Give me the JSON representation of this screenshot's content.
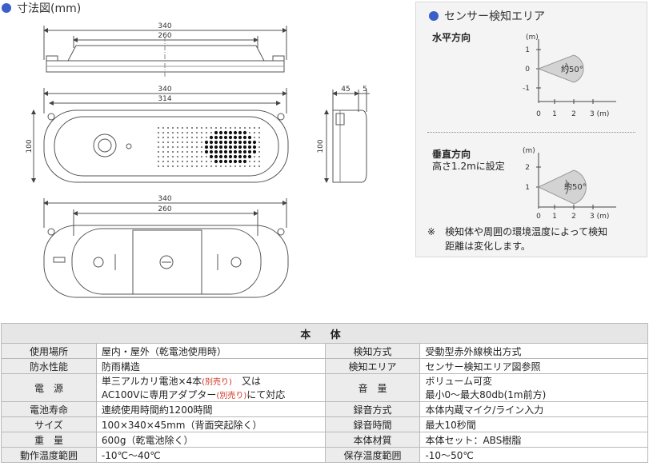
{
  "left_header": "寸法図(mm)",
  "front_view": {
    "dim_outer": "340",
    "dim_inner": "260",
    "dim_inner_b": "314",
    "height": "100"
  },
  "top_view": {
    "dim_outer": "340",
    "dim_inner": "260"
  },
  "side_view": {
    "depth": "45",
    "lip": "5",
    "height": "100"
  },
  "right_panel": {
    "header": "センサー検知エリア",
    "horizontal": {
      "label": "水平方向",
      "unit": "(m)",
      "yticks": [
        "1",
        "0",
        "-1"
      ],
      "xticks": [
        "0",
        "1",
        "2",
        "3 (m)"
      ],
      "angle": "約50°"
    },
    "vertical": {
      "label": "垂直方向",
      "sublabel": "高さ1.2mに設定",
      "unit": "(m)",
      "yticks": [
        "2",
        "1",
        "0"
      ],
      "xticks": [
        "0",
        "1",
        "2",
        "3 (m)"
      ],
      "angle": "約50°"
    },
    "note_mark": "※",
    "note_line1": "検知体や周囲の環境温度によって検知",
    "note_line2": "距離は変化します。"
  },
  "spec_table": {
    "title": "本 体",
    "rows": [
      {
        "l1": "使用場所",
        "v1": "屋内・屋外（乾電池使用時）",
        "l2": "検知方式",
        "v2": "受動型赤外線検出方式"
      },
      {
        "l1": "防水性能",
        "v1": "防雨構造",
        "l2": "検知エリア",
        "v2": "センサー検知エリア図参照"
      },
      {
        "l1": "電　源",
        "v1a": "単三アルカリ電池×4本",
        "v1a_red": "(別売り)",
        "v1a_tail": "又は",
        "v1b": "AC100Vに専用アダプター",
        "v1b_red": "(別売り)",
        "v1b_tail": "にて対応",
        "l2": "音　量",
        "v2a": "ボリューム可変",
        "v2b": "最小0〜最大80db(1m前方)"
      },
      {
        "l1": "電池寿命",
        "v1": "連続使用時間約1200時間",
        "l2": "録音方式",
        "v2": "本体内蔵マイク/ライン入力"
      },
      {
        "l1": "サイズ",
        "v1": "100×340×45mm（背面突起除く）",
        "l2": "録音時間",
        "v2": "最大10秒間"
      },
      {
        "l1": "重　量",
        "v1": "600g（乾電池除く）",
        "l2": "本体材質",
        "v2": "本体セット：ABS樹脂"
      },
      {
        "l1": "動作温度範囲",
        "v1": "-10℃〜40℃",
        "l2": "保存温度範囲",
        "v2": "-10〜50℃"
      }
    ]
  }
}
